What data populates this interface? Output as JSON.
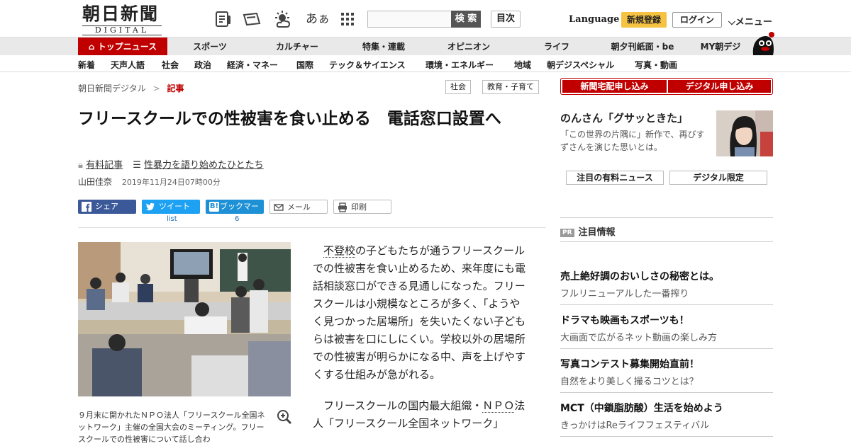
{
  "header": {
    "logo_kanji": "朝日新聞",
    "logo_sub": "DIGITAL",
    "aa_label": "あぁ",
    "search_placeholder": "",
    "search_button": "検 索",
    "toc_button": "目次",
    "language": "Language",
    "register": "新規登録",
    "login": "ログイン",
    "menu": "メニュー"
  },
  "nav_primary": [
    "トップニュース",
    "スポーツ",
    "カルチャー",
    "特集・連載",
    "オピニオン",
    "ライフ",
    "朝夕刊紙面・be",
    "MY朝デジ"
  ],
  "nav_secondary": [
    "新着",
    "天声人語",
    "社会",
    "政治",
    "経済・マネー",
    "国際",
    "テック＆サイエンス",
    "環境・エネルギー",
    "地域",
    "朝デジスペシャル",
    "写真・動画"
  ],
  "breadcrumb": {
    "root": "朝日新聞デジタル",
    "sep": ">",
    "current": "記事"
  },
  "tags": [
    "社会",
    "教育・子育て"
  ],
  "article": {
    "title": "フリースクールでの性被害を食い止める　電話窓口設置へ",
    "paid_label": "有料記事",
    "series_label": "性暴力を語り始めたひとたち",
    "author": "山田佳奈",
    "date": "2019年11月24日07時00分",
    "caption": "９月末に開かれたＮＰＯ法人「フリースクール全国ネットワーク」主催の全国大会のミーティング。フリースクールでの性被害について話し合わ",
    "p1_link": "不登校",
    "p1_rest": "の子どもたちが通うフリースクールでの性被害を食い止めるため、来年度にも電話相談窓口ができる見通しになった。フリースクールは小規模なところが多く、「ようやく見つかった居場所」を失いたくない子どもらは被害を口にしにくい。学校以外の居場所での性被害が明らかになる中、声を上げやすくする仕組みが急がれる。",
    "p2_pre": "フリースクールの国内最大組織・",
    "p2_link": "ＮＰＯ",
    "p2_rest": "法人「フリースクール全国ネットワーク」"
  },
  "share": {
    "facebook": "シェア",
    "twitter": "ツイート",
    "twitter_count": "list",
    "hatena": "ブックマーク",
    "hatena_count": "6",
    "mail": "メール",
    "print": "印刷"
  },
  "sidebar": {
    "subscribe_paper": "新聞宅配申し込み",
    "subscribe_digital": "デジタル申し込み",
    "feature_title": "のんさん「グサッときた」",
    "feature_desc": "「この世界の片隅に」新作で、再びすずさんを演じた思いとは。",
    "btn_paid_news": "注目の有料ニュース",
    "btn_digital_only": "デジタル限定",
    "pr_badge": "PR",
    "pr_heading": "注目情報",
    "pr_items": [
      {
        "title": "売上絶好調のおいしさの秘密とは。",
        "desc": "フルリニューアルした一番搾り"
      },
      {
        "title": "ドラマも映画もスポーツも！",
        "desc": "大画面で広がるネット動画の楽しみ方"
      },
      {
        "title": "写真コンテスト募集開始直前！",
        "desc": "自然をより美しく撮るコツとは？"
      },
      {
        "title": "MCT（中鎖脂肪酸）生活を始めよう",
        "desc": "きっかけはReライフフェスティバル"
      }
    ]
  },
  "colors": {
    "accent": "#c00000",
    "nav_bg": "#e9e9e9",
    "facebook": "#3b5998",
    "twitter": "#1da1f2",
    "hatena": "#1e90d6",
    "register": "#f5c242"
  }
}
